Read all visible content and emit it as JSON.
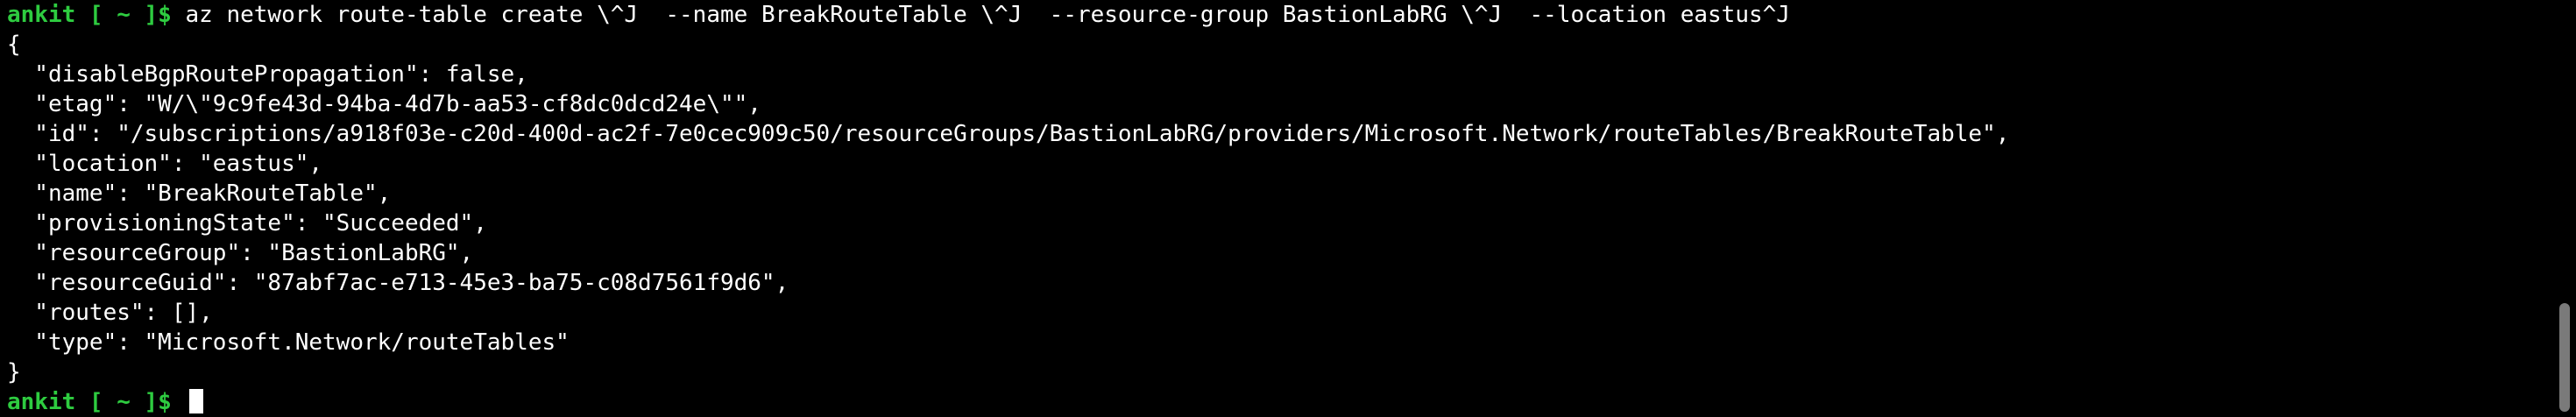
{
  "terminal": {
    "prompt": "ankit [ ~ ]$",
    "command": "az network route-table create \\^J  --name BreakRouteTable \\^J  --resource-group BastionLabRG \\^J  --location eastus^J",
    "output_lines": [
      "{",
      "  \"disableBgpRoutePropagation\": false,",
      "  \"etag\": \"W/\\\"9c9fe43d-94ba-4d7b-aa53-cf8dc0dcd24e\\\"\",",
      "  \"id\": \"/subscriptions/a918f03e-c20d-400d-ac2f-7e0cec909c50/resourceGroups/BastionLabRG/providers/Microsoft.Network/routeTables/BreakRouteTable\",",
      "  \"location\": \"eastus\",",
      "  \"name\": \"BreakRouteTable\",",
      "  \"provisioningState\": \"Succeeded\",",
      "  \"resourceGroup\": \"BastionLabRG\",",
      "  \"resourceGuid\": \"87abf7ac-e713-45e3-ba75-c08d7561f9d6\",",
      "  \"routes\": [],",
      "  \"type\": \"Microsoft.Network/routeTables\"",
      "}"
    ],
    "second_prompt": "ankit [ ~ ]$",
    "colors": {
      "background": "#000000",
      "prompt": "#2ecc40",
      "text": "#ffffff"
    }
  }
}
